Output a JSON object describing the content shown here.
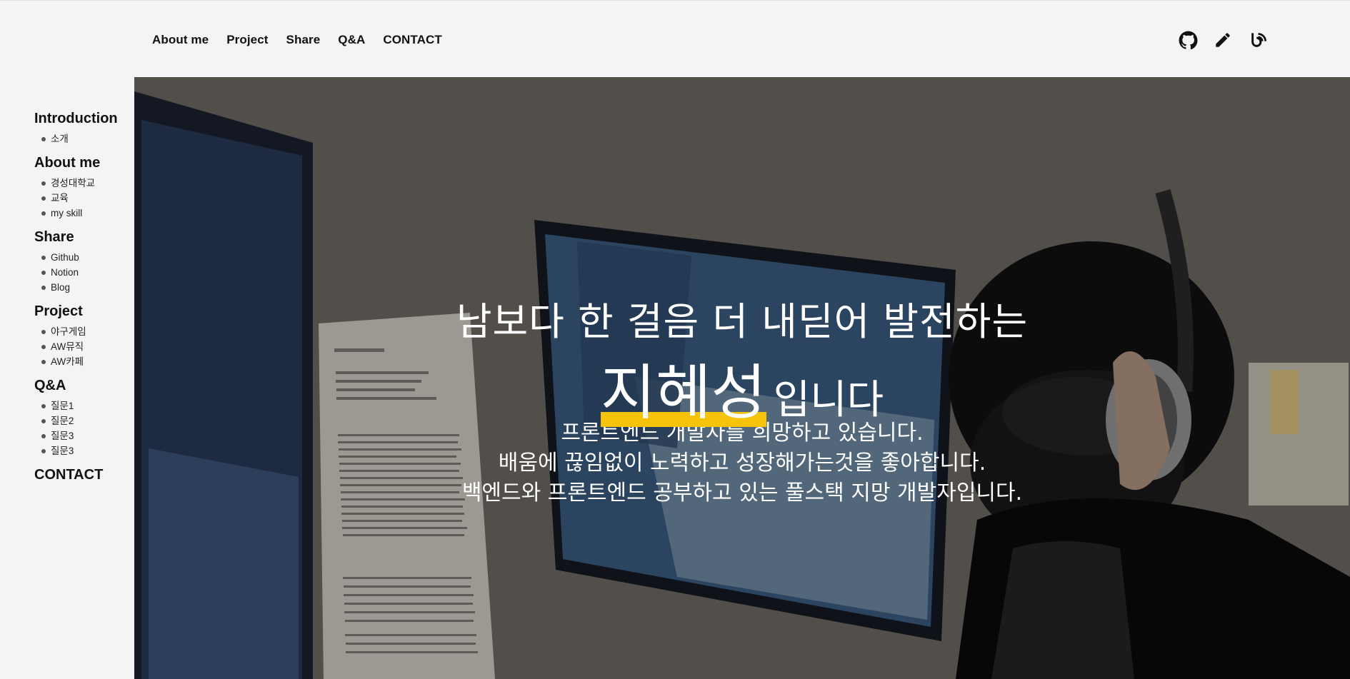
{
  "nav": {
    "items": [
      "About me",
      "Project",
      "Share",
      "Q&A",
      "CONTACT"
    ]
  },
  "header_icons": [
    "github-icon",
    "pencil-icon",
    "blog-icon"
  ],
  "sidebar": {
    "sections": [
      {
        "title": "Introduction",
        "items": [
          "소개"
        ]
      },
      {
        "title": "About me",
        "items": [
          "경성대학교",
          "교육",
          "my skill"
        ]
      },
      {
        "title": "Share",
        "items": [
          "Github",
          "Notion",
          "Blog"
        ]
      },
      {
        "title": "Project",
        "items": [
          "야구게임",
          "AW뮤직",
          "AW카페"
        ]
      },
      {
        "title": "Q&A",
        "items": [
          "질문1",
          "질문2",
          "질문3",
          "질문3"
        ]
      },
      {
        "title": "CONTACT",
        "items": []
      }
    ]
  },
  "hero": {
    "headline": "남보다 한 걸음 더 내딛어 발전하는",
    "name": "지혜성",
    "name_suffix": "입니다",
    "description": [
      "프론트엔드 개발자를 희망하고 있습니다.",
      "배움에 끊임없이 노력하고 성장해가는것을 좋아합니다.",
      "백엔드와 프론트엔드 공부하고 있는 풀스택 지망 개발자입니다."
    ],
    "highlight_color": "#f5c40a"
  }
}
